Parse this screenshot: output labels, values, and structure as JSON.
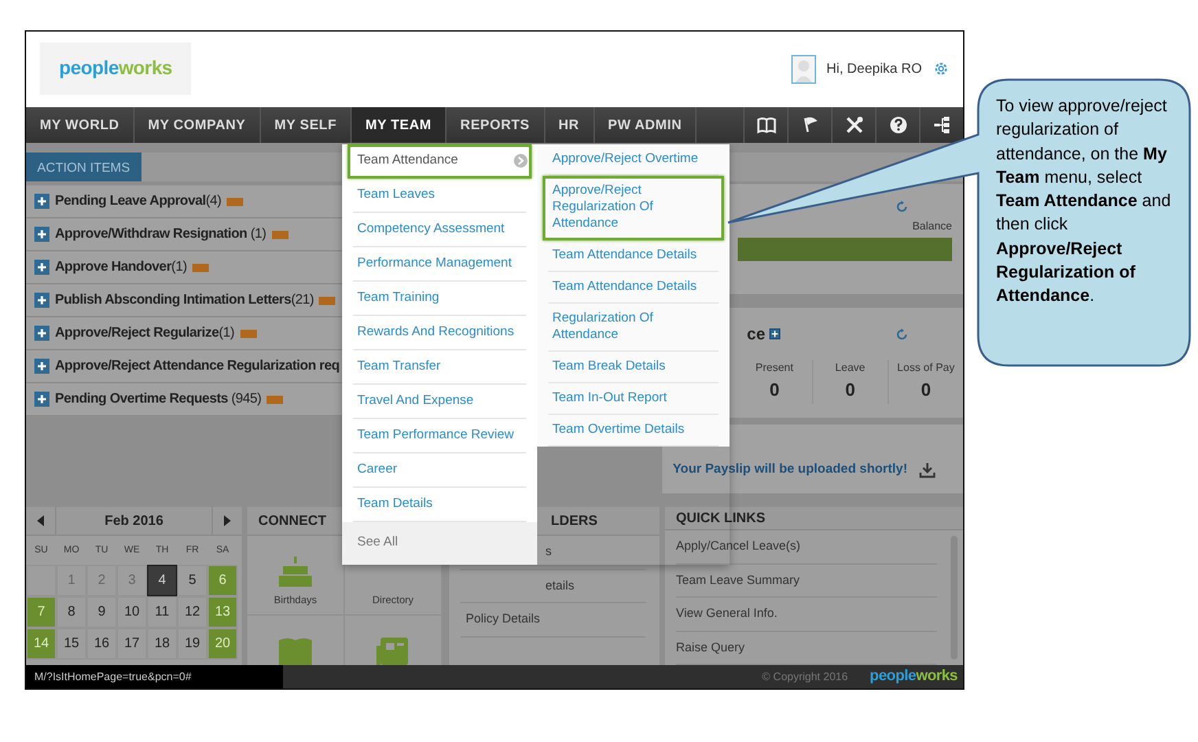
{
  "header": {
    "logo": [
      "people",
      "works"
    ],
    "greeting": "Hi, Deepika RO"
  },
  "nav": {
    "tabs": [
      {
        "label": "MY WORLD",
        "selected": false
      },
      {
        "label": "MY COMPANY",
        "selected": false
      },
      {
        "label": "MY SELF",
        "selected": false
      },
      {
        "label": "MY TEAM",
        "selected": true
      },
      {
        "label": "REPORTS",
        "selected": false
      },
      {
        "label": "HR",
        "selected": false
      },
      {
        "label": "PW ADMIN",
        "selected": false
      }
    ],
    "tools": [
      {
        "kind": "book"
      },
      {
        "kind": "flag"
      },
      {
        "kind": "tools"
      },
      {
        "kind": "help"
      },
      {
        "kind": "sitemap"
      }
    ]
  },
  "action_items": {
    "title": "ACTION ITEMS",
    "items": [
      {
        "label": "**Pending Leave Approval**(4)",
        "new": true
      },
      {
        "label": "**Approve/Withdraw Resignation** (1)",
        "new": true
      },
      {
        "label": "**Approve Handover**(1)",
        "new": true
      },
      {
        "label": "**Publish Absconding Intimation Letters**(21)",
        "new": true
      },
      {
        "label": "**Approve/Reject Regularize**(1)",
        "new": true
      },
      {
        "label": "**Approve/Reject Attendance Regularization req**",
        "new": false
      },
      {
        "label": "**Pending Overtime Requests** (945)",
        "new": true
      }
    ]
  },
  "leave_balance": {
    "label": "Balance"
  },
  "attendance": {
    "title": "ce",
    "columns": [
      {
        "label": "Present",
        "value": "0"
      },
      {
        "label": "Leave",
        "value": "0"
      },
      {
        "label": "Loss of Pay",
        "value": "0"
      }
    ]
  },
  "payslip": {
    "message": "Your Payslip will be uploaded shortly!"
  },
  "calendar": {
    "month": "Feb 2016",
    "weekdays": [
      "SU",
      "MO",
      "TU",
      "WE",
      "TH",
      "FR",
      "SA"
    ],
    "weeks": [
      [
        {
          "kind": "blank"
        },
        {
          "day": "1",
          "kind": "past"
        },
        {
          "day": "2",
          "kind": "past"
        },
        {
          "day": "3",
          "kind": "past"
        },
        {
          "day": "4",
          "kind": "today"
        },
        {
          "day": "5",
          "kind": "day"
        },
        {
          "day": "6",
          "kind": "weekend"
        }
      ],
      [
        {
          "day": "7",
          "kind": "weekend"
        },
        {
          "day": "8",
          "kind": "day"
        },
        {
          "day": "9",
          "kind": "day"
        },
        {
          "day": "10",
          "kind": "day"
        },
        {
          "day": "11",
          "kind": "day"
        },
        {
          "day": "12",
          "kind": "day"
        },
        {
          "day": "13",
          "kind": "weekend"
        }
      ],
      [
        {
          "day": "14",
          "kind": "weekend"
        },
        {
          "day": "15",
          "kind": "day"
        },
        {
          "day": "16",
          "kind": "day"
        },
        {
          "day": "17",
          "kind": "day"
        },
        {
          "day": "18",
          "kind": "day"
        },
        {
          "day": "19",
          "kind": "day"
        },
        {
          "day": "20",
          "kind": "weekend"
        }
      ]
    ]
  },
  "connect": {
    "title": "CONNECT",
    "tiles": [
      {
        "kind": "birthdays",
        "label": "Birthdays"
      },
      {
        "kind": "directory",
        "label": "Directory"
      },
      {
        "kind": "book"
      },
      {
        "kind": "news"
      }
    ]
  },
  "reminders": {
    "title": "LDERS",
    "items": [
      "s",
      "etails",
      "Policy Details"
    ]
  },
  "quick_links": {
    "title": "QUICK LINKS",
    "items": [
      "Apply/Cancel Leave(s)",
      "Team Leave Summary",
      "View General Info.",
      "Raise Query"
    ]
  },
  "menu": {
    "columns": [
      {
        "items": [
          {
            "label": "Team Attendance",
            "selected": true,
            "highlighted": true
          },
          {
            "label": "Team Leaves",
            "selected": false,
            "highlighted": false
          },
          {
            "label": "Competency Assessment",
            "selected": false,
            "highlighted": false
          },
          {
            "label": "Performance Management",
            "selected": false,
            "highlighted": false
          },
          {
            "label": "Team Training",
            "selected": false,
            "highlighted": false
          },
          {
            "label": "Rewards And Recognitions",
            "selected": false,
            "highlighted": false
          },
          {
            "label": "Team Transfer",
            "selected": false,
            "highlighted": false
          },
          {
            "label": "Travel And Expense",
            "selected": false,
            "highlighted": false
          },
          {
            "label": "Team Performance Review",
            "selected": false,
            "highlighted": false
          },
          {
            "label": "Career",
            "selected": false,
            "highlighted": false
          },
          {
            "label": "Team Details",
            "selected": false,
            "highlighted": false
          }
        ],
        "footer": "See All"
      },
      {
        "items": [
          {
            "label": "Approve/Reject Overtime",
            "selected": false,
            "highlighted": false
          },
          {
            "label": "Approve/Reject Regularization Of Attendance",
            "selected": false,
            "highlighted": true
          },
          {
            "label": "Team Attendance Details",
            "selected": false,
            "highlighted": false
          },
          {
            "label": "Team Attendance Details",
            "selected": false,
            "highlighted": false
          },
          {
            "label": "Regularization Of Attendance",
            "selected": false,
            "highlighted": false
          },
          {
            "label": "Team Break Details",
            "selected": false,
            "highlighted": false
          },
          {
            "label": "Team In-Out Report",
            "selected": false,
            "highlighted": false
          },
          {
            "label": "Team Overtime Details",
            "selected": false,
            "highlighted": false
          }
        ]
      }
    ]
  },
  "status_bar": {
    "url": "M/?IsItHomePage=true&pcn=0#",
    "copyright": "© Copyright 2016",
    "logo": [
      "people",
      "works"
    ]
  },
  "callout": {
    "text": "To view approve/reject regularization of attendance, on the **My Team** menu, select **Team Attendance** and then click **Approve/Reject Regularization of Attendance**."
  }
}
